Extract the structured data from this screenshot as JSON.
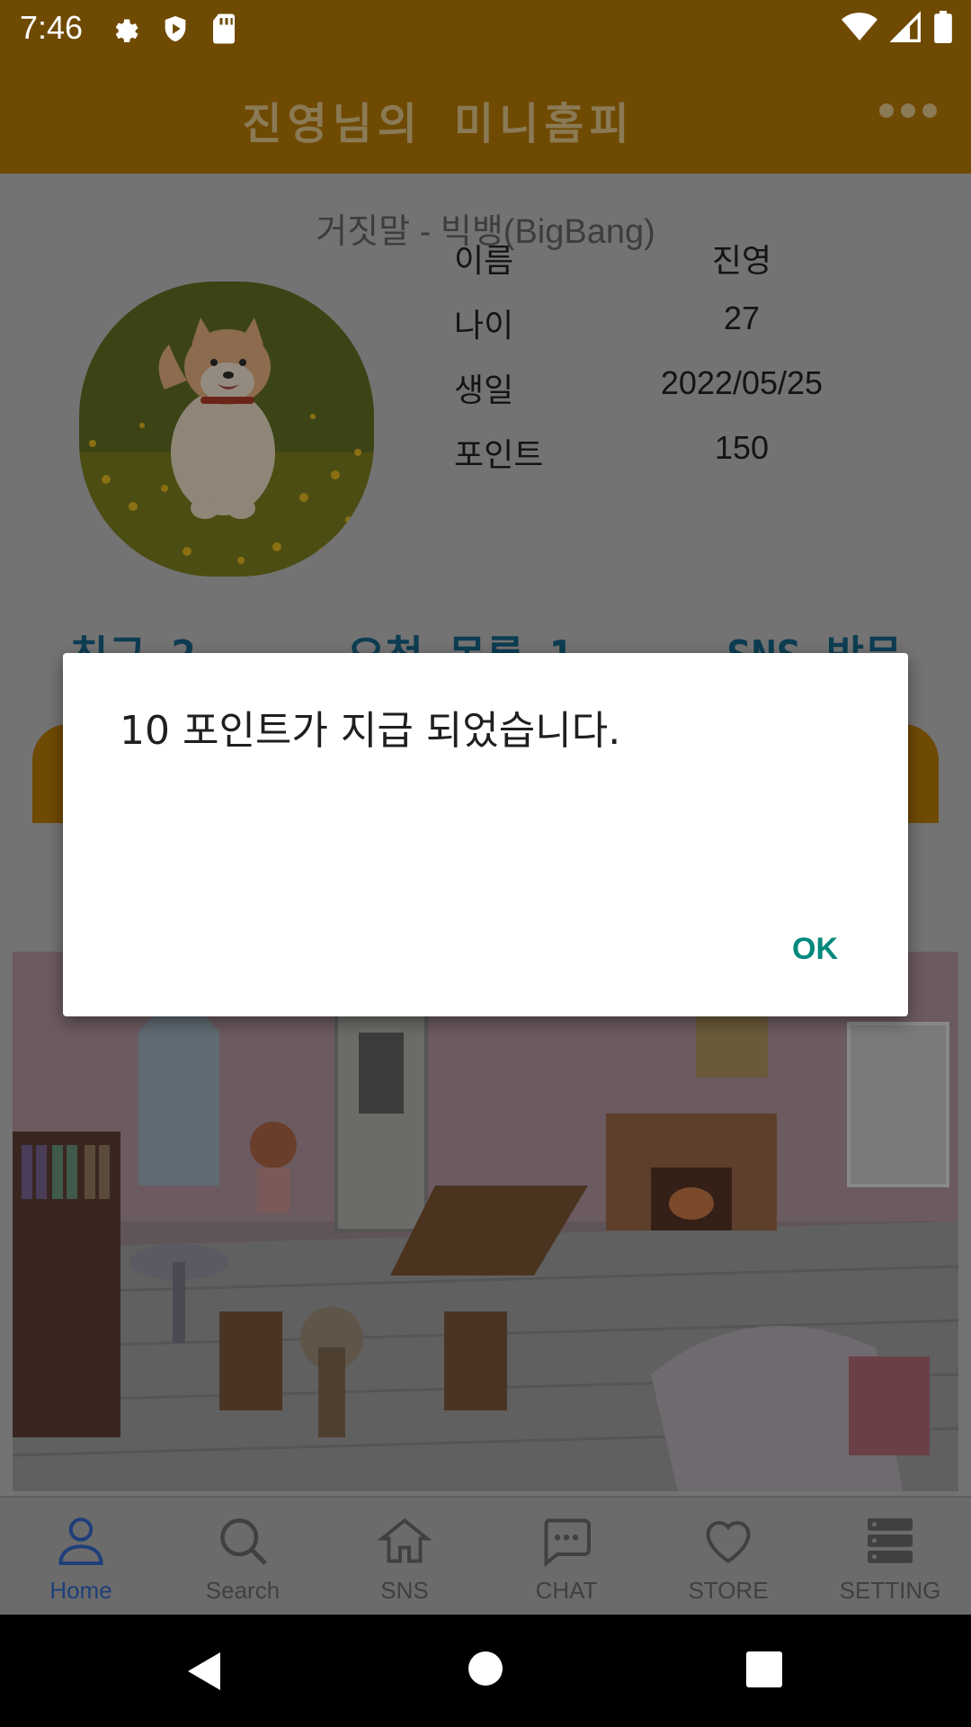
{
  "status_bar": {
    "time": "7:46"
  },
  "app_bar": {
    "title": "진영님의 미니홈피"
  },
  "profile": {
    "bgm": "거짓말 - 빅뱅(BigBang)",
    "rows": [
      {
        "label": "이름",
        "value": "진영"
      },
      {
        "label": "나이",
        "value": "27"
      },
      {
        "label": "생일",
        "value": "2022/05/25"
      },
      {
        "label": "포인트",
        "value": "150"
      }
    ]
  },
  "links": {
    "friends": "친구 2",
    "requests": "요청 목록 1",
    "sns": "SNS 방문"
  },
  "bottom_nav": [
    {
      "label": "Home",
      "icon": "person-icon",
      "active": true
    },
    {
      "label": "Search",
      "icon": "search-icon",
      "active": false
    },
    {
      "label": "SNS",
      "icon": "home-icon",
      "active": false
    },
    {
      "label": "CHAT",
      "icon": "chat-icon",
      "active": false
    },
    {
      "label": "STORE",
      "icon": "heart-icon",
      "active": false
    },
    {
      "label": "SETTING",
      "icon": "storage-icon",
      "active": false
    }
  ],
  "dialog": {
    "message": "10 포인트가 지급 되었습니다.",
    "ok_label": "OK"
  },
  "colors": {
    "app_bar": "#6f4a03",
    "active_tab": "#1f3f7a",
    "dialog_button": "#00897b"
  }
}
